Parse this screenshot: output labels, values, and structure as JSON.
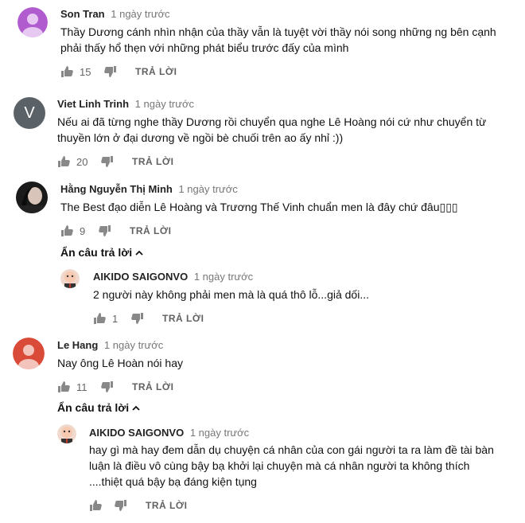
{
  "comments": [
    {
      "author": "Son Tran",
      "time": "1 ngày trước",
      "text": "Thầy Dương cánh nhìn nhận của thầy vẫn là tuyệt vời thầy nói song những ng bên cạnh\nphải thấy hổ thẹn với những phát biểu trước đấy của mình",
      "likes": "15",
      "reply_label": "TRẢ LỜI",
      "avatar_color": "#b05ccf"
    },
    {
      "author": "Viet Linh Trinh",
      "time": "1 ngày trước",
      "text": "Nếu ai đã từng nghe thầy Dương rồi chuyển qua nghe Lê Hoàng nói cứ như chuyển từ\nthuyền lớn ở đại dương về ngồi bè chuối trên ao ấy nhỉ :))",
      "likes": "20",
      "reply_label": "TRẢ LỜI",
      "avatar_letter": "V",
      "avatar_color": "#5a6268"
    },
    {
      "author": "Hằng Nguyễn Thị Minh",
      "time": "1 ngày trước",
      "text": "The Best đạo diễn Lê Hoàng và Trương Thế Vinh chuẩn men là đây chứ đâu▯▯▯",
      "likes": "9",
      "reply_label": "TRẢ LỜI",
      "hide_replies_label": "Ẩn câu trả lời"
    },
    {
      "author": "AIKIDO SAIGONVO",
      "time": "1 ngày trước",
      "text": "2 người này không phải men mà là quá thô lỗ...giả dối...",
      "likes": "1",
      "reply_label": "TRẢ LỜI"
    },
    {
      "author": "Le Hang",
      "time": "1 ngày trước",
      "text": "Nay ông Lê Hoàn nói hay",
      "likes": "11",
      "reply_label": "TRẢ LỜI",
      "hide_replies_label": "Ẩn câu trả lời",
      "avatar_color": "#d94a38"
    },
    {
      "author": "AIKIDO SAIGONVO",
      "time": "1 ngày trước",
      "text": "hay gì mà hay đem dẫn dụ chuyện cá nhân của con gái người ta ra làm đề tài bàn\nluận là điều vô cùng bậy bạ khởi lại chuyện mà cá nhân người ta không thích\n....thiệt quá bậy bạ đáng kiện tụng",
      "likes": "",
      "reply_label": "TRẢ LỜI"
    }
  ]
}
